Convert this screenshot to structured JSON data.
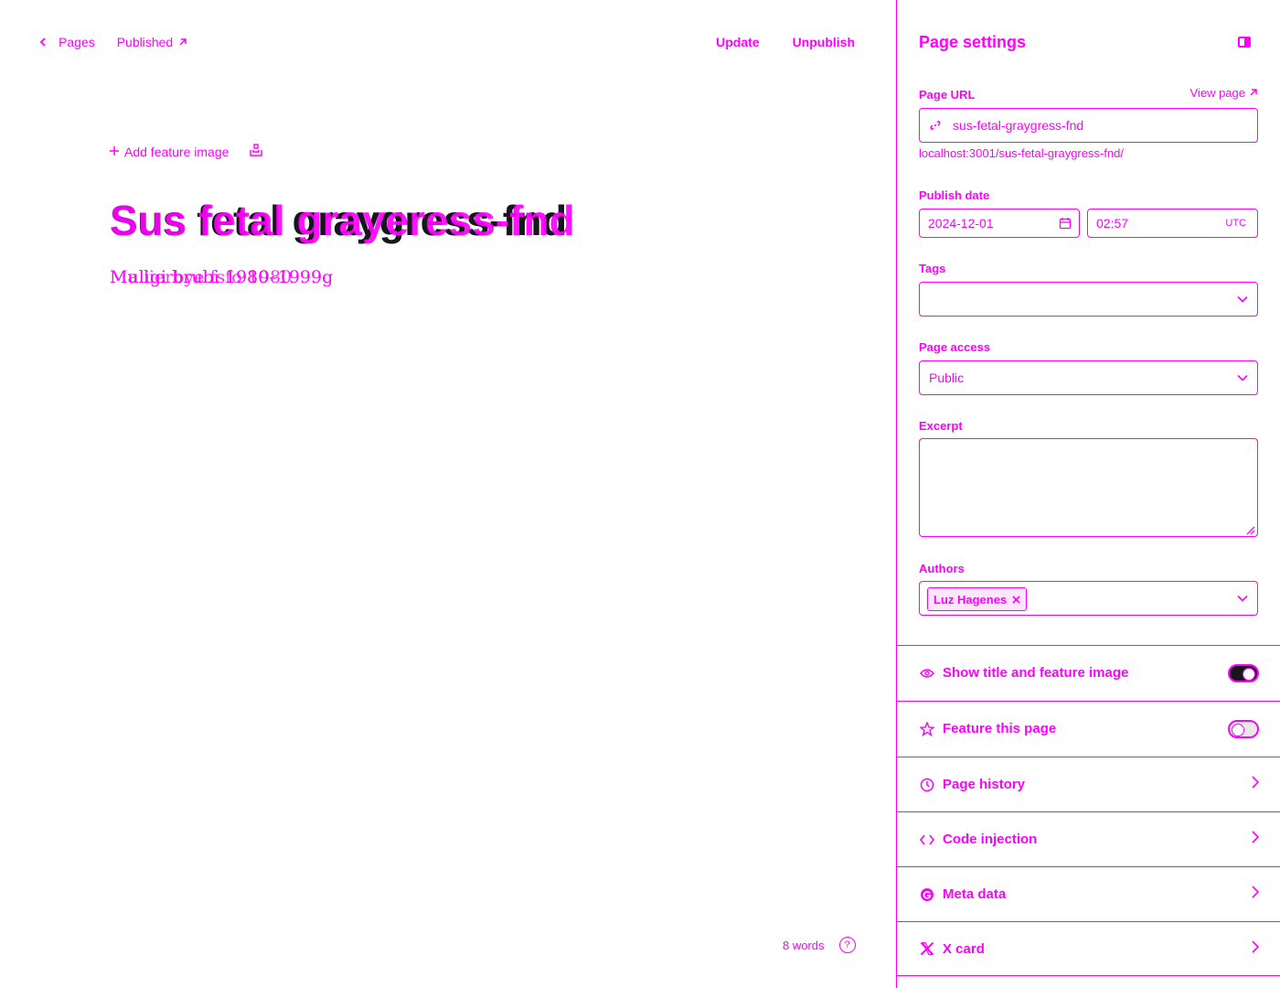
{
  "header": {
    "back_label": "Pages",
    "status_label": "Published",
    "update_label": "Update",
    "unpublish_label": "Unpublish"
  },
  "editor": {
    "add_feature_image_label": "Add feature image",
    "title_rendered": "Sus fetal graygress-fnd",
    "title_overlay": "Sus fetal grayeress-fnd",
    "excerpt_rendered": "Muligi brubi 1980–1999g",
    "excerpt_overlay": "Ma lierbye fsfo 1980",
    "word_count": "8 words"
  },
  "panel": {
    "title": "Page settings",
    "url_label": "Page URL",
    "view_page_label": "View page",
    "slug_value": "sus-fetal-graygress-fnd",
    "url_preview": "localhost:3001/sus-fetal-graygress-fnd/",
    "publish_date_label": "Publish date",
    "date_value": "2024-12-01",
    "time_value": "02:57",
    "timezone": "UTC",
    "tags_label": "Tags",
    "tags_value": "",
    "access_label": "Page access",
    "access_value": "Public",
    "excerpt_label": "Excerpt",
    "excerpt_value": "",
    "authors_label": "Authors",
    "author_chip": "Luz Hagenes",
    "rows": {
      "show_title": "Show title and feature image",
      "feature_page": "Feature this page",
      "history": "Page history",
      "code_injection": "Code injection",
      "meta_data": "Meta data",
      "x_card": "X card"
    },
    "show_title_on": true,
    "feature_page_on": false
  },
  "colors": {
    "accent": "#ff00ff",
    "text": "#15171a"
  }
}
